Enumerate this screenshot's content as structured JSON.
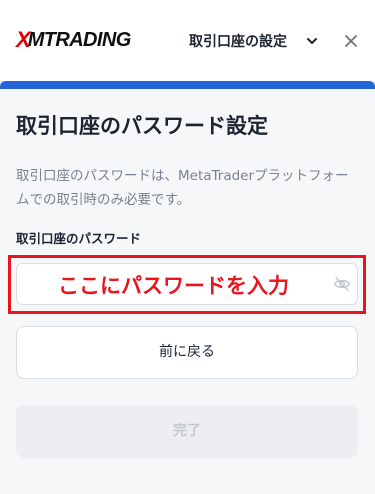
{
  "header": {
    "logo_mark": "X",
    "logo_text": "MTRADING",
    "logo_full": "XMTRADING",
    "step_title": "取引口座の設定",
    "step_dropdown_icon": "chevron-down-icon",
    "close_icon": "close-icon"
  },
  "progress": {
    "fraction": 1.0,
    "color": "#2563d9"
  },
  "main": {
    "title": "取引口座のパスワード設定",
    "description": "取引口座のパスワードは、MetaTraderプラットフォームでの取引時のみ必要です。",
    "password_label": "取引口座のパスワード",
    "password_value": "",
    "password_visibility_icon": "eye-slash-icon",
    "annotation_text": "ここにパスワードを入力",
    "annotation_color": "#e8141e",
    "back_button": "前に戻る",
    "done_button": "完了"
  }
}
